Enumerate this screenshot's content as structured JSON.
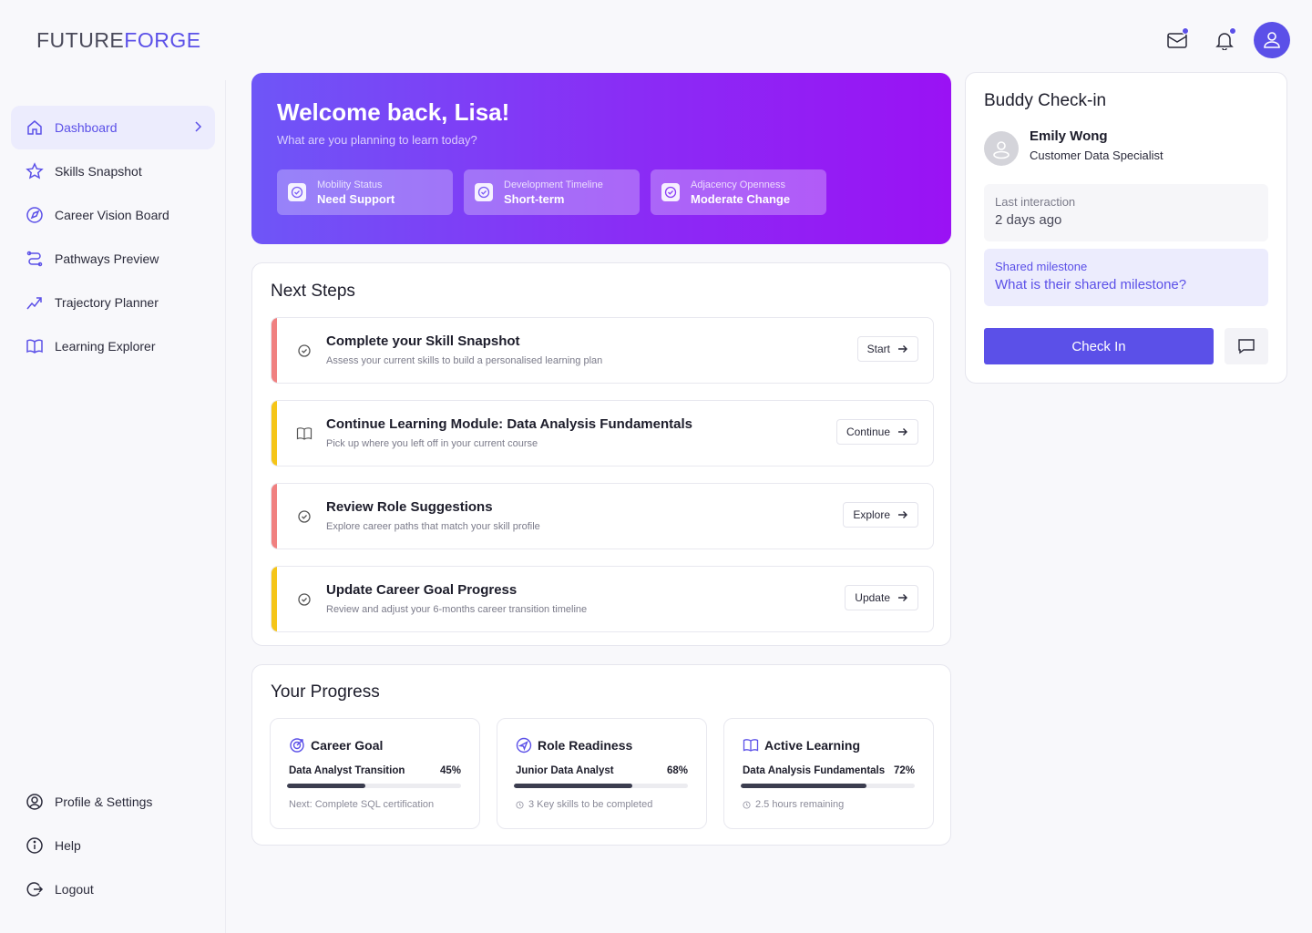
{
  "brand": {
    "part1": "FUTURE",
    "part2": "FORGE"
  },
  "header": {
    "mail_icon": "mail-icon",
    "bell_icon": "bell-icon",
    "avatar_icon": "user-icon"
  },
  "sidebar": {
    "items": [
      {
        "label": "Dashboard",
        "icon": "home-icon",
        "active": true
      },
      {
        "label": "Skills Snapshot",
        "icon": "star-icon"
      },
      {
        "label": "Career Vision Board",
        "icon": "compass-icon"
      },
      {
        "label": "Pathways Preview",
        "icon": "route-icon"
      },
      {
        "label": "Trajectory Planner",
        "icon": "trend-icon"
      },
      {
        "label": "Learning Explorer",
        "icon": "book-icon"
      }
    ],
    "bottom": [
      {
        "label": "Profile & Settings",
        "icon": "profile-icon"
      },
      {
        "label": "Help",
        "icon": "info-icon"
      },
      {
        "label": "Logout",
        "icon": "logout-icon"
      }
    ]
  },
  "hero": {
    "title": "Welcome back, Lisa!",
    "subtitle": "What are you planning to learn today?",
    "chips": [
      {
        "label": "Mobility Status",
        "value": "Need Support"
      },
      {
        "label": "Development Timeline",
        "value": "Short-term"
      },
      {
        "label": "Adjacency Openness",
        "value": "Moderate Change"
      }
    ]
  },
  "next_steps": {
    "title": "Next Steps",
    "items": [
      {
        "title": "Complete your Skill Snapshot",
        "desc": "Assess your current skills to build a personalised learning plan",
        "button": "Start",
        "color": "#f08080",
        "icon": "check-circle-icon"
      },
      {
        "title": "Continue Learning Module: Data Analysis Fundamentals",
        "desc": "Pick up where you left off in your current course",
        "button": "Continue",
        "color": "#f5c518",
        "icon": "book-icon"
      },
      {
        "title": "Review Role Suggestions",
        "desc": "Explore career paths that match your skill profile",
        "button": "Explore",
        "color": "#f08080",
        "icon": "check-circle-icon"
      },
      {
        "title": "Update Career Goal Progress",
        "desc": "Review and adjust your 6-months career transition timeline",
        "button": "Update",
        "color": "#f5c518",
        "icon": "check-circle-icon"
      }
    ]
  },
  "progress": {
    "title": "Your Progress",
    "cards": [
      {
        "heading": "Career Goal",
        "icon": "target-icon",
        "label": "Data Analyst Transition",
        "percent_text": "45%",
        "percent": 45,
        "note": "Next: Complete SQL certification",
        "note_icon": ""
      },
      {
        "heading": "Role Readiness",
        "icon": "navigation-icon",
        "label": "Junior Data Analyst",
        "percent_text": "68%",
        "percent": 68,
        "note": "3 Key skills to be completed",
        "note_icon": "clock-icon"
      },
      {
        "heading": "Active Learning",
        "icon": "book-icon",
        "label": "Data Analysis Fundamentals",
        "percent_text": "72%",
        "percent": 72,
        "note": "2.5 hours remaining",
        "note_icon": "clock-icon"
      }
    ]
  },
  "buddy": {
    "title": "Buddy Check-in",
    "name": "Emily Wong",
    "role": "Customer Data Specialist",
    "last_label": "Last interaction",
    "last_value": "2 days ago",
    "milestone_label": "Shared milestone",
    "milestone_value": "What is their shared milestone?",
    "button": "Check In",
    "chat_icon": "chat-icon"
  },
  "colors": {
    "accent": "#5b50e8",
    "coral": "#f08080",
    "yellow": "#f5c518"
  }
}
